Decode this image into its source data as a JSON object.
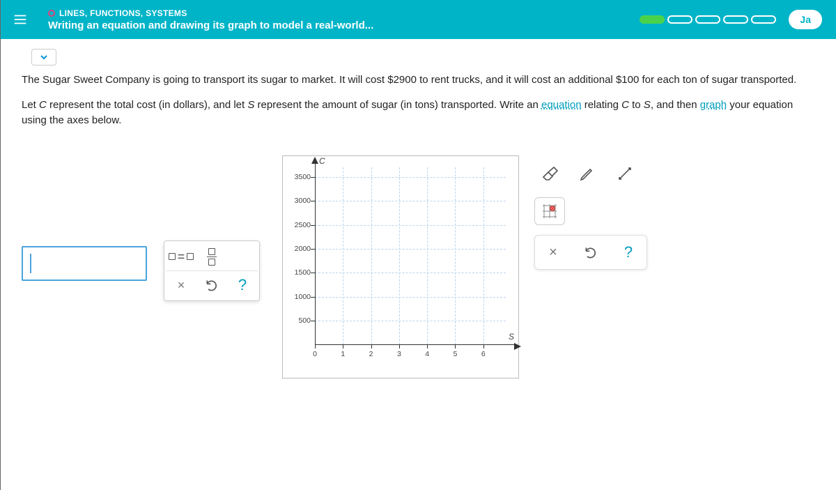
{
  "header": {
    "breadcrumb": "LINES, FUNCTIONS, SYSTEMS",
    "title": "Writing an equation and drawing its graph to model a real-world...",
    "user": "Ja"
  },
  "progress": {
    "total": 5,
    "filled": 1
  },
  "problem": {
    "p1_a": "The Sugar Sweet Company is going to transport its sugar to market. It will cost ",
    "p1_b": "$2900",
    "p1_c": " to rent trucks, and it will cost an additional ",
    "p1_d": "$100",
    "p1_e": " for each ton of sugar transported.",
    "p2_a": "Let ",
    "p2_b": "C",
    "p2_c": " represent the total cost (in dollars), and let ",
    "p2_d": "S",
    "p2_e": " represent the amount of sugar (in tons) transported. Write an ",
    "p2_link1": "equation",
    "p2_f": " relating ",
    "p2_g": "C",
    "p2_h": " to ",
    "p2_i": "S",
    "p2_j": ", and then ",
    "p2_link2": "graph",
    "p2_k": " your equation using the axes below."
  },
  "equation_tools": {
    "equals": "▢=▢",
    "fraction": "▢/▢",
    "close": "×",
    "undo": "↺",
    "help": "?"
  },
  "graph_tools": {
    "eraser": "eraser",
    "pencil": "pencil",
    "line": "line",
    "point": "point",
    "close": "×",
    "undo": "↺",
    "help": "?"
  },
  "chart_data": {
    "type": "scatter",
    "title": "",
    "xlabel": "S",
    "ylabel": "C",
    "x_ticks": [
      0,
      1,
      2,
      3,
      4,
      5,
      6
    ],
    "y_ticks": [
      500,
      1000,
      1500,
      2000,
      2500,
      3000,
      3500
    ],
    "xlim": [
      0,
      6.8
    ],
    "ylim": [
      0,
      3700
    ],
    "series": []
  }
}
